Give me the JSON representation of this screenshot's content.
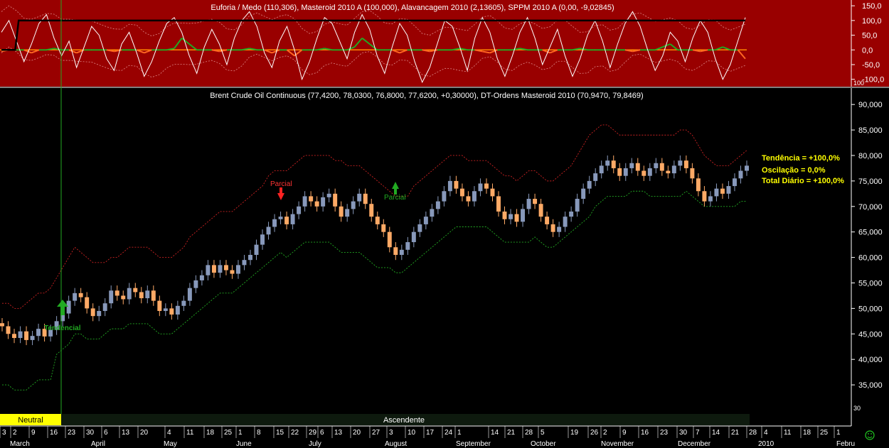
{
  "upper_panel": {
    "title": "Euforia / Medo (110,306), Masteroid 2010 A (100,000), Alavancagem 2010 (2,13605), SPPM 2010 A (0,00, -9,02845)",
    "y_ticks": [
      "150,0",
      "100,0",
      "50,0",
      "0,0",
      "-50,0",
      "-100,0"
    ],
    "corner_label": "100",
    "ylim": [
      -120,
      160
    ],
    "colors": {
      "background": "#990000",
      "oscillator": "#ffffff",
      "masteroid": "#000000",
      "dashed_bands": "#dd8888",
      "positive_bars": "#22aa22",
      "negative_bars": "#ff6622",
      "zero_line": "#ff8800"
    }
  },
  "main_panel": {
    "title": "Brent Crude Oil Continuous (77,4200, 78,0300, 76,8000, 77,6200, +0,30000), DT-Ordens Masteroid 2010 (70,9470, 79,8469)",
    "y_ticks": [
      "90,000",
      "85,000",
      "80,000",
      "75,000",
      "70,000",
      "65,000",
      "60,000",
      "55,000",
      "50,000",
      "45,000",
      "40,000",
      "35,000"
    ],
    "corner_label": "30",
    "info": {
      "tendencia": "Tendência = +100,0%",
      "oscilacao": "Oscilação = 0,0%",
      "total_diario": "Total Diário = +100,0%"
    },
    "annotations": {
      "tendencial": "Tendencial",
      "parcial_red": "Parcial",
      "parcial_green": "Parcial"
    },
    "status_bar": {
      "neutral": "Neutral",
      "ascendente": "Ascendente"
    },
    "colors": {
      "bull_candle": "#8899bb",
      "bear_candle": "#ffaa66",
      "upper_band": "#cc2222",
      "lower_band": "#22aa22",
      "info_text": "#ffff00",
      "status_neutral": "#ffff00"
    }
  },
  "x_axis": {
    "day_labels": [
      "3",
      "2",
      "9",
      "16",
      "23",
      "30",
      "6",
      "13",
      "20",
      "4",
      "11",
      "18",
      "25",
      "1",
      "8",
      "15",
      "22",
      "29",
      "6",
      "13",
      "20",
      "27",
      "3",
      "10",
      "17",
      "24",
      "1",
      "14",
      "21",
      "28",
      "5",
      "19",
      "26",
      "2",
      "9",
      "16",
      "23",
      "30",
      "7",
      "14",
      "21",
      "28",
      "4",
      "11",
      "18",
      "25",
      "1"
    ],
    "month_labels": [
      "March",
      "April",
      "May",
      "June",
      "July",
      "August",
      "September",
      "October",
      "November",
      "December",
      "2010",
      "Febru"
    ]
  },
  "chart_data": [
    {
      "type": "line",
      "title": "Euforia / Medo (110,306), Masteroid 2010 A (100,000), Alavancagem 2010 (2,13605), SPPM 2010 A (0,00, -9,02845)",
      "ylim": [
        -120,
        160
      ],
      "series": [
        {
          "name": "Masteroid 2010 A",
          "values": [
            0,
            0,
            0,
            0,
            0,
            100,
            100,
            100,
            100,
            100,
            100,
            100,
            100,
            100,
            100,
            100,
            100,
            100,
            100,
            100,
            100,
            100,
            100,
            100,
            100,
            100,
            100,
            100,
            100,
            100,
            100,
            100,
            100,
            100,
            100,
            100,
            100,
            100,
            100,
            100,
            100,
            100,
            100,
            100,
            100,
            100,
            100,
            100,
            100,
            100,
            100,
            100,
            100,
            100,
            100,
            100,
            100,
            100,
            100,
            100,
            100,
            100,
            100,
            100,
            100,
            100,
            100,
            100,
            100,
            100,
            100,
            100,
            100,
            100,
            100,
            100,
            100,
            100,
            100,
            100,
            100,
            100,
            100,
            100,
            100,
            100,
            100,
            100,
            100,
            100,
            100,
            100,
            100,
            100,
            100,
            100,
            100,
            100,
            100,
            100,
            100,
            100,
            100,
            100,
            100,
            100,
            100,
            100,
            100,
            100,
            100,
            100,
            100,
            100,
            100,
            100,
            100,
            100,
            100,
            100,
            100,
            100,
            100,
            100,
            100,
            100,
            100,
            100,
            100,
            100,
            100,
            100,
            100,
            100,
            100,
            100,
            100,
            100,
            100,
            100,
            100,
            100,
            100,
            100,
            100,
            100,
            100,
            100,
            100,
            100,
            100,
            100,
            100,
            100,
            100,
            100,
            100,
            100,
            100,
            100,
            100,
            100,
            100,
            100,
            100,
            100,
            100,
            100,
            100,
            100,
            100,
            100,
            100,
            100,
            100,
            100,
            100,
            100,
            100,
            100,
            100,
            100,
            100,
            100,
            100,
            100,
            100,
            100,
            100,
            100,
            100,
            100,
            100,
            100,
            100,
            100,
            100,
            100,
            100,
            100,
            100,
            100,
            100,
            100,
            100,
            100,
            100,
            100,
            100,
            100,
            100,
            100,
            100,
            100,
            100,
            100,
            100
          ]
        },
        {
          "name": "Euforia / Medo",
          "values": [
            60,
            100,
            30,
            -40,
            20,
            90,
            120,
            40,
            -20,
            30,
            -60,
            10,
            80,
            50,
            -30,
            -70,
            20,
            60,
            -10,
            -90,
            -40,
            30,
            90,
            110,
            60,
            -20,
            -80,
            10,
            70,
            20,
            -50,
            40,
            100,
            130,
            80,
            -10,
            -60,
            30,
            80,
            0,
            -100,
            -40,
            40,
            110,
            90,
            30,
            -30,
            60,
            120,
            70,
            -20,
            -80,
            10,
            90,
            50,
            -40,
            -110,
            -60,
            20,
            100,
            80,
            10,
            -70,
            40,
            110,
            60,
            -30,
            -90,
            -20,
            60,
            110,
            40,
            -50,
            10,
            70,
            -20,
            -90,
            -30,
            50,
            100,
            30,
            -60,
            20,
            90,
            130,
            80,
            0,
            -70,
            -20,
            60,
            30,
            -40,
            40,
            100,
            60,
            -30,
            -100,
            -50,
            30,
            110
          ]
        },
        {
          "name": "SPPM 2010 A",
          "values": [
            -5,
            0,
            0,
            0,
            -10,
            0,
            0,
            5,
            0,
            0,
            -10,
            0,
            0,
            0,
            0,
            -5,
            0,
            0,
            0,
            -10,
            0,
            0,
            0,
            5,
            40,
            20,
            0,
            0,
            0,
            -5,
            0,
            0,
            0,
            5,
            0,
            0,
            -10,
            0,
            0,
            -20,
            0,
            0,
            0,
            5,
            0,
            0,
            0,
            10,
            40,
            20,
            0,
            0,
            0,
            -10,
            0,
            0,
            0,
            -5,
            0,
            0,
            0,
            5,
            0,
            0,
            -5,
            -10,
            0,
            0,
            0,
            5,
            0,
            0,
            0,
            -10,
            0,
            0,
            0,
            5,
            0,
            0,
            0,
            0,
            0,
            0,
            -5,
            0,
            0,
            0,
            10,
            20,
            0,
            0,
            0,
            -5,
            0,
            0,
            10,
            0,
            0,
            -30
          ]
        }
      ]
    },
    {
      "type": "candlestick",
      "title": "Brent Crude Oil Continuous (77,4200, 78,0300, 76,8000, 77,6200, +0,30000), DT-Ordens Masteroid 2010 (70,9470, 79,8469)",
      "ylim": [
        30,
        91
      ],
      "close": [
        46.5,
        45.0,
        44.2,
        45.5,
        43.8,
        44.6,
        46.0,
        44.5,
        45.8,
        47.5,
        49.0,
        51.5,
        53.0,
        52.2,
        50.0,
        48.5,
        49.5,
        51.0,
        53.5,
        52.5,
        51.8,
        54.0,
        53.2,
        52.0,
        53.5,
        51.5,
        49.5,
        50.0,
        48.8,
        50.5,
        51.5,
        54.0,
        55.5,
        56.5,
        58.5,
        57.0,
        58.5,
        57.5,
        56.8,
        58.5,
        59.5,
        60.5,
        62.5,
        64.5,
        66.0,
        67.5,
        68.0,
        66.5,
        68.5,
        70.0,
        72.0,
        71.0,
        70.0,
        71.8,
        72.5,
        70.0,
        68.0,
        69.5,
        71.0,
        72.5,
        70.5,
        68.0,
        66.5,
        65.0,
        62.0,
        60.5,
        61.5,
        63.0,
        65.0,
        66.5,
        68.0,
        69.5,
        71.0,
        73.0,
        75.0,
        73.5,
        72.0,
        71.0,
        73.0,
        74.5,
        73.5,
        72.0,
        69.0,
        67.5,
        68.5,
        67.0,
        69.5,
        71.5,
        70.5,
        68.0,
        66.5,
        65.0,
        66.0,
        68.0,
        69.0,
        71.5,
        73.5,
        75.0,
        76.5,
        78.0,
        79.0,
        77.5,
        76.0,
        77.5,
        78.5,
        77.0,
        76.0,
        77.5,
        78.5,
        77.0,
        76.5,
        78.0,
        79.0,
        77.5,
        75.5,
        73.0,
        71.0,
        72.0,
        73.5,
        72.5,
        74.0,
        75.5,
        77.0,
        78.0
      ]
    },
    {
      "type": "line",
      "name": "DT-Ordens Masteroid 2010 upper",
      "ylim": [
        30,
        91
      ],
      "values": [
        51,
        51,
        50,
        50,
        51,
        52,
        53,
        53,
        54,
        56,
        58,
        60,
        62,
        61,
        60,
        59,
        59,
        59,
        60,
        60,
        61,
        62,
        62,
        62,
        62,
        61,
        60,
        60,
        60,
        61,
        62,
        64,
        65,
        66,
        67,
        68,
        69,
        69,
        69,
        70,
        71,
        72,
        73,
        74,
        76,
        77,
        77,
        77,
        78,
        79,
        80,
        80,
        80,
        80,
        80,
        79,
        79,
        78,
        78,
        78,
        77,
        76,
        75,
        74,
        73,
        72,
        72,
        72,
        74,
        75,
        76,
        77,
        78,
        79,
        80,
        80,
        80,
        79,
        79,
        79,
        79,
        78,
        77,
        76,
        76,
        75,
        76,
        77,
        77,
        76,
        75,
        75,
        76,
        77,
        78,
        80,
        82,
        84,
        85,
        86,
        86,
        85,
        84,
        84,
        84,
        84,
        84,
        84,
        84,
        84,
        84,
        84,
        85,
        85,
        84,
        82,
        80,
        79,
        78,
        78,
        78,
        79,
        80,
        81
      ]
    },
    {
      "type": "line",
      "name": "DT-Ordens Masteroid 2010 lower",
      "ylim": [
        30,
        91
      ],
      "values": [
        35,
        35,
        34,
        34,
        34,
        35,
        36,
        36,
        36,
        41,
        42,
        43,
        45,
        45,
        44,
        44,
        44,
        45,
        46,
        46,
        46,
        47,
        47,
        47,
        47,
        46,
        45,
        45,
        45,
        46,
        47,
        48,
        49,
        50,
        51,
        52,
        53,
        53,
        53,
        54,
        55,
        56,
        57,
        58,
        59,
        60,
        61,
        60,
        61,
        62,
        63,
        63,
        63,
        63,
        63,
        62,
        61,
        61,
        61,
        61,
        60,
        59,
        58,
        58,
        58,
        57,
        57,
        58,
        59,
        60,
        61,
        62,
        63,
        64,
        65,
        66,
        66,
        66,
        66,
        66,
        66,
        65,
        64,
        63,
        63,
        63,
        63,
        63,
        64,
        63,
        62,
        62,
        63,
        64,
        65,
        66,
        67,
        68,
        70,
        71,
        72,
        72,
        72,
        72,
        73,
        73,
        73,
        72,
        72,
        72,
        72,
        72,
        72,
        73,
        72,
        71,
        70,
        70,
        70,
        70,
        70,
        70,
        71,
        71
      ]
    }
  ]
}
